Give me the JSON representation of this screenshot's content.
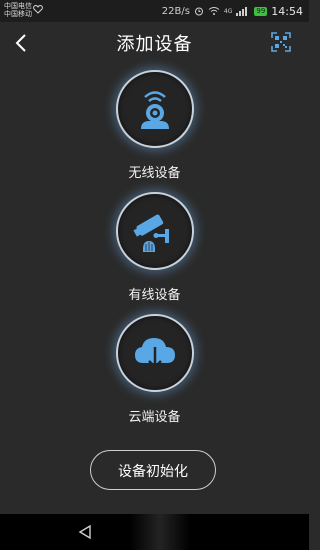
{
  "status_bar": {
    "carrier_1": "中国电信",
    "carrier_2": "中国移动",
    "speed": "22B/s",
    "network_type": "4G",
    "battery": "99",
    "time": "14:54"
  },
  "header": {
    "title": "添加设备"
  },
  "devices": [
    {
      "label": "无线设备",
      "icon": "wireless-camera-icon"
    },
    {
      "label": "有线设备",
      "icon": "wired-camera-icon"
    },
    {
      "label": "云端设备",
      "icon": "cloud-download-icon"
    }
  ],
  "init_button": {
    "label": "设备初始化"
  },
  "colors": {
    "background": "#2a2a2a",
    "accent_blue": "#5aa7e6",
    "ring": "#c9d2db"
  }
}
